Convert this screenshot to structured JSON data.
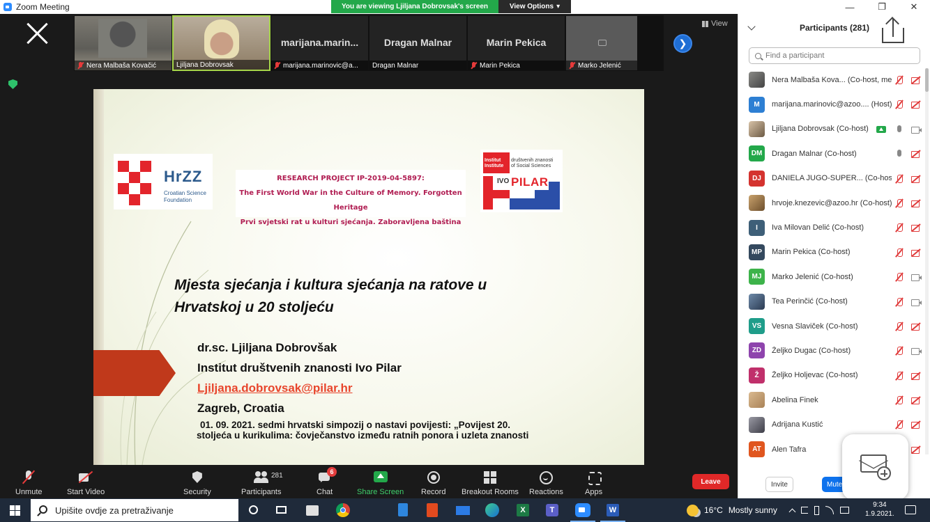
{
  "window": {
    "title": "Zoom Meeting",
    "controls": {
      "minimize": "—",
      "maximize": "❐",
      "close": "✕"
    }
  },
  "banner": {
    "viewing": "You are viewing Ljiljana Dobrovsak's screen",
    "view_options": "View Options",
    "view_options_caret": "▾"
  },
  "strip": {
    "tiles": [
      {
        "label": "Nera Malbaša Kovačić",
        "muted": true
      },
      {
        "label": "Ljiljana Dobrovsak",
        "muted": false
      },
      {
        "big": "marijana.marin...",
        "label": "marijana.marinovic@a...",
        "muted": true
      },
      {
        "big": "Dragan Malnar",
        "label": "Dragan Malnar",
        "muted": false
      },
      {
        "big": "Marin Pekica",
        "label": "Marin Pekica",
        "muted": true
      },
      {
        "label": "Marko Jelenić",
        "muted": true
      }
    ],
    "next_arrow": "❯",
    "view_label": "View"
  },
  "slide": {
    "hrzz_word": "HrZZ",
    "hrzz_sub": [
      "Croatian Science",
      "Foundation"
    ],
    "project_lines": [
      "RESEARCH PROJECT IP-2019-04-5897:",
      "The First World War in the Culture of Memory. Forgotten Heritage",
      "Prvi svjetski rat u kulturi sjećanja. Zaboravljena baština"
    ],
    "pilar_lines": [
      "Institut",
      "Institute",
      "društvenih znanosti",
      "of Social Sciences",
      "IVO"
    ],
    "pilar_word": "PILAR",
    "title_lines": [
      "Mjesta sjećanja i kultura sjećanja na ratove u",
      "Hrvatskoj u 20 stoljeću"
    ],
    "author": "dr.sc. Ljiljana Dobrovšak",
    "institute": "Institut društvenih znanosti Ivo Pilar",
    "email": "Ljiljana.dobrovsak@pilar.hr",
    "location": "Zagreb, Croatia",
    "event_lines": [
      "01. 09. 2021. sedmi hrvatski simpozij o nastavi povijesti: „Povijest 20.",
      "stoljeća u kurikulima: čovječanstvo između ratnih ponora i uzleta znanosti"
    ]
  },
  "participants": {
    "title": "Participants (281)",
    "search_placeholder": "Find a participant",
    "list": [
      {
        "name": "Nera Malbaša Kova...",
        "role": "(Co-host, me)",
        "avatar": "",
        "avatar_color": "",
        "avatar_style": "photo",
        "mic": "muted",
        "cam": "muted",
        "sharing": false
      },
      {
        "name": "marijana.marinovic@azoo....",
        "role": "(Host)",
        "avatar": "M",
        "avatar_color": "#2d7fd3",
        "avatar_style": "",
        "mic": "muted",
        "cam": "muted",
        "sharing": false
      },
      {
        "name": "Ljiljana Dobrovsak",
        "role": "(Co-host)",
        "avatar": "",
        "avatar_color": "",
        "avatar_style": "photo3",
        "mic": "on",
        "cam": "on",
        "sharing": true
      },
      {
        "name": "Dragan Malnar",
        "role": "(Co-host)",
        "avatar": "DM",
        "avatar_color": "#23a84a",
        "avatar_style": "",
        "mic": "on",
        "cam": "muted",
        "sharing": false
      },
      {
        "name": "DANIELA JUGO-SUPER...",
        "role": "(Co-host)",
        "avatar": "DJ",
        "avatar_color": "#d4332f",
        "avatar_style": "",
        "mic": "muted",
        "cam": "muted",
        "sharing": false
      },
      {
        "name": "hrvoje.knezevic@azoo.hr",
        "role": "(Co-host)",
        "avatar": "",
        "avatar_color": "",
        "avatar_style": "photo2",
        "mic": "muted",
        "cam": "muted",
        "sharing": false
      },
      {
        "name": "Iva Milovan Delić",
        "role": "(Co-host)",
        "avatar": "I",
        "avatar_color": "#3e5f78",
        "avatar_style": "",
        "mic": "muted",
        "cam": "muted",
        "sharing": false
      },
      {
        "name": "Marin Pekica",
        "role": "(Co-host)",
        "avatar": "MP",
        "avatar_color": "#34495e",
        "avatar_style": "",
        "mic": "muted",
        "cam": "muted",
        "sharing": false
      },
      {
        "name": "Marko Jelenić",
        "role": "(Co-host)",
        "avatar": "MJ",
        "avatar_color": "#3db34a",
        "avatar_style": "",
        "mic": "muted",
        "cam": "on",
        "sharing": false
      },
      {
        "name": "Tea Perinčić",
        "role": "(Co-host)",
        "avatar": "",
        "avatar_color": "",
        "avatar_style": "photo4",
        "mic": "muted",
        "cam": "on",
        "sharing": false
      },
      {
        "name": "Vesna Slaviček",
        "role": "(Co-host)",
        "avatar": "VS",
        "avatar_color": "#1f9d8a",
        "avatar_style": "",
        "mic": "muted",
        "cam": "muted",
        "sharing": false
      },
      {
        "name": "Željko Dugac",
        "role": "(Co-host)",
        "avatar": "ZD",
        "avatar_color": "#8e44ad",
        "avatar_style": "",
        "mic": "muted",
        "cam": "on",
        "sharing": false
      },
      {
        "name": "Željko Holjevac",
        "role": "(Co-host)",
        "avatar": "Ž",
        "avatar_color": "#c0306b",
        "avatar_style": "",
        "mic": "muted",
        "cam": "muted",
        "sharing": false
      },
      {
        "name": "Abelina Finek",
        "role": "",
        "avatar": "",
        "avatar_color": "",
        "avatar_style": "photo5",
        "mic": "muted",
        "cam": "muted",
        "sharing": false
      },
      {
        "name": "Adrijana Kustić",
        "role": "",
        "avatar": "",
        "avatar_color": "",
        "avatar_style": "photo6",
        "mic": "muted",
        "cam": "muted",
        "sharing": false
      },
      {
        "name": "Alen Tafra",
        "role": "",
        "avatar": "AT",
        "avatar_color": "#e0561f",
        "avatar_style": "",
        "mic": "muted",
        "cam": "muted",
        "sharing": false
      }
    ],
    "invite": "Invite",
    "mute_all": "Mute"
  },
  "toolbar": {
    "unmute": "Unmute",
    "start_video": "Start Video",
    "security": "Security",
    "participants": "Participants",
    "participants_count": "281",
    "chat": "Chat",
    "chat_badge": "6",
    "share_screen": "Share Screen",
    "record": "Record",
    "breakout": "Breakout Rooms",
    "reactions": "Reactions",
    "apps": "Apps",
    "leave": "Leave"
  },
  "taskbar": {
    "search_placeholder": "Upišite ovdje za pretraživanje",
    "weather_temp": "16°C",
    "weather_text": "Mostly sunny",
    "time": "9:34",
    "date": "1.9.2021."
  }
}
